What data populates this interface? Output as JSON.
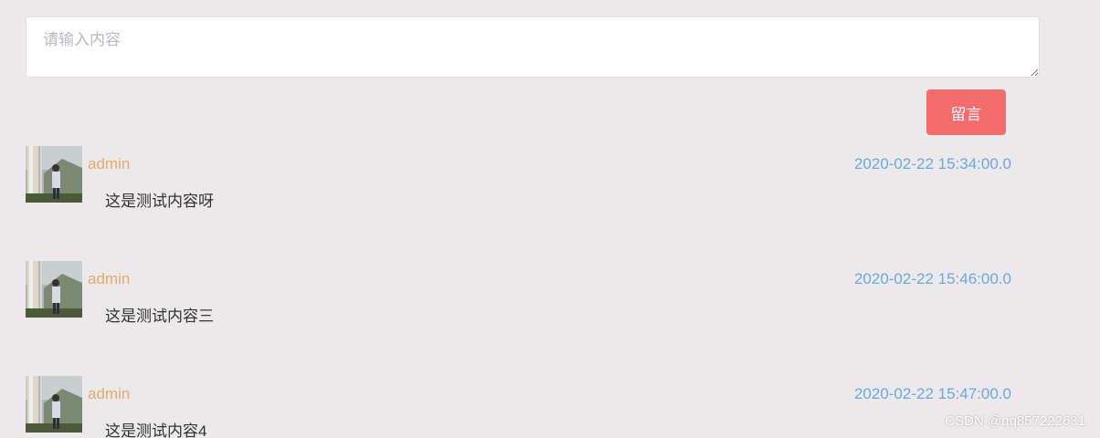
{
  "form": {
    "input_placeholder": "请输入内容",
    "input_value": "",
    "submit_label": "留言"
  },
  "comments": [
    {
      "username": "admin",
      "timestamp": "2020-02-22 15:34:00.0",
      "content": "这是测试内容呀"
    },
    {
      "username": "admin",
      "timestamp": "2020-02-22 15:46:00.0",
      "content": "这是测试内容三"
    },
    {
      "username": "admin",
      "timestamp": "2020-02-22 15:47:00.0",
      "content": "这是测试内容4"
    }
  ],
  "colors": {
    "background": "#ece9ea",
    "button": "#f56c6c",
    "username": "#e2a96e",
    "timestamp": "#6aa7e3"
  },
  "watermark": "CSDN @qq857222631"
}
